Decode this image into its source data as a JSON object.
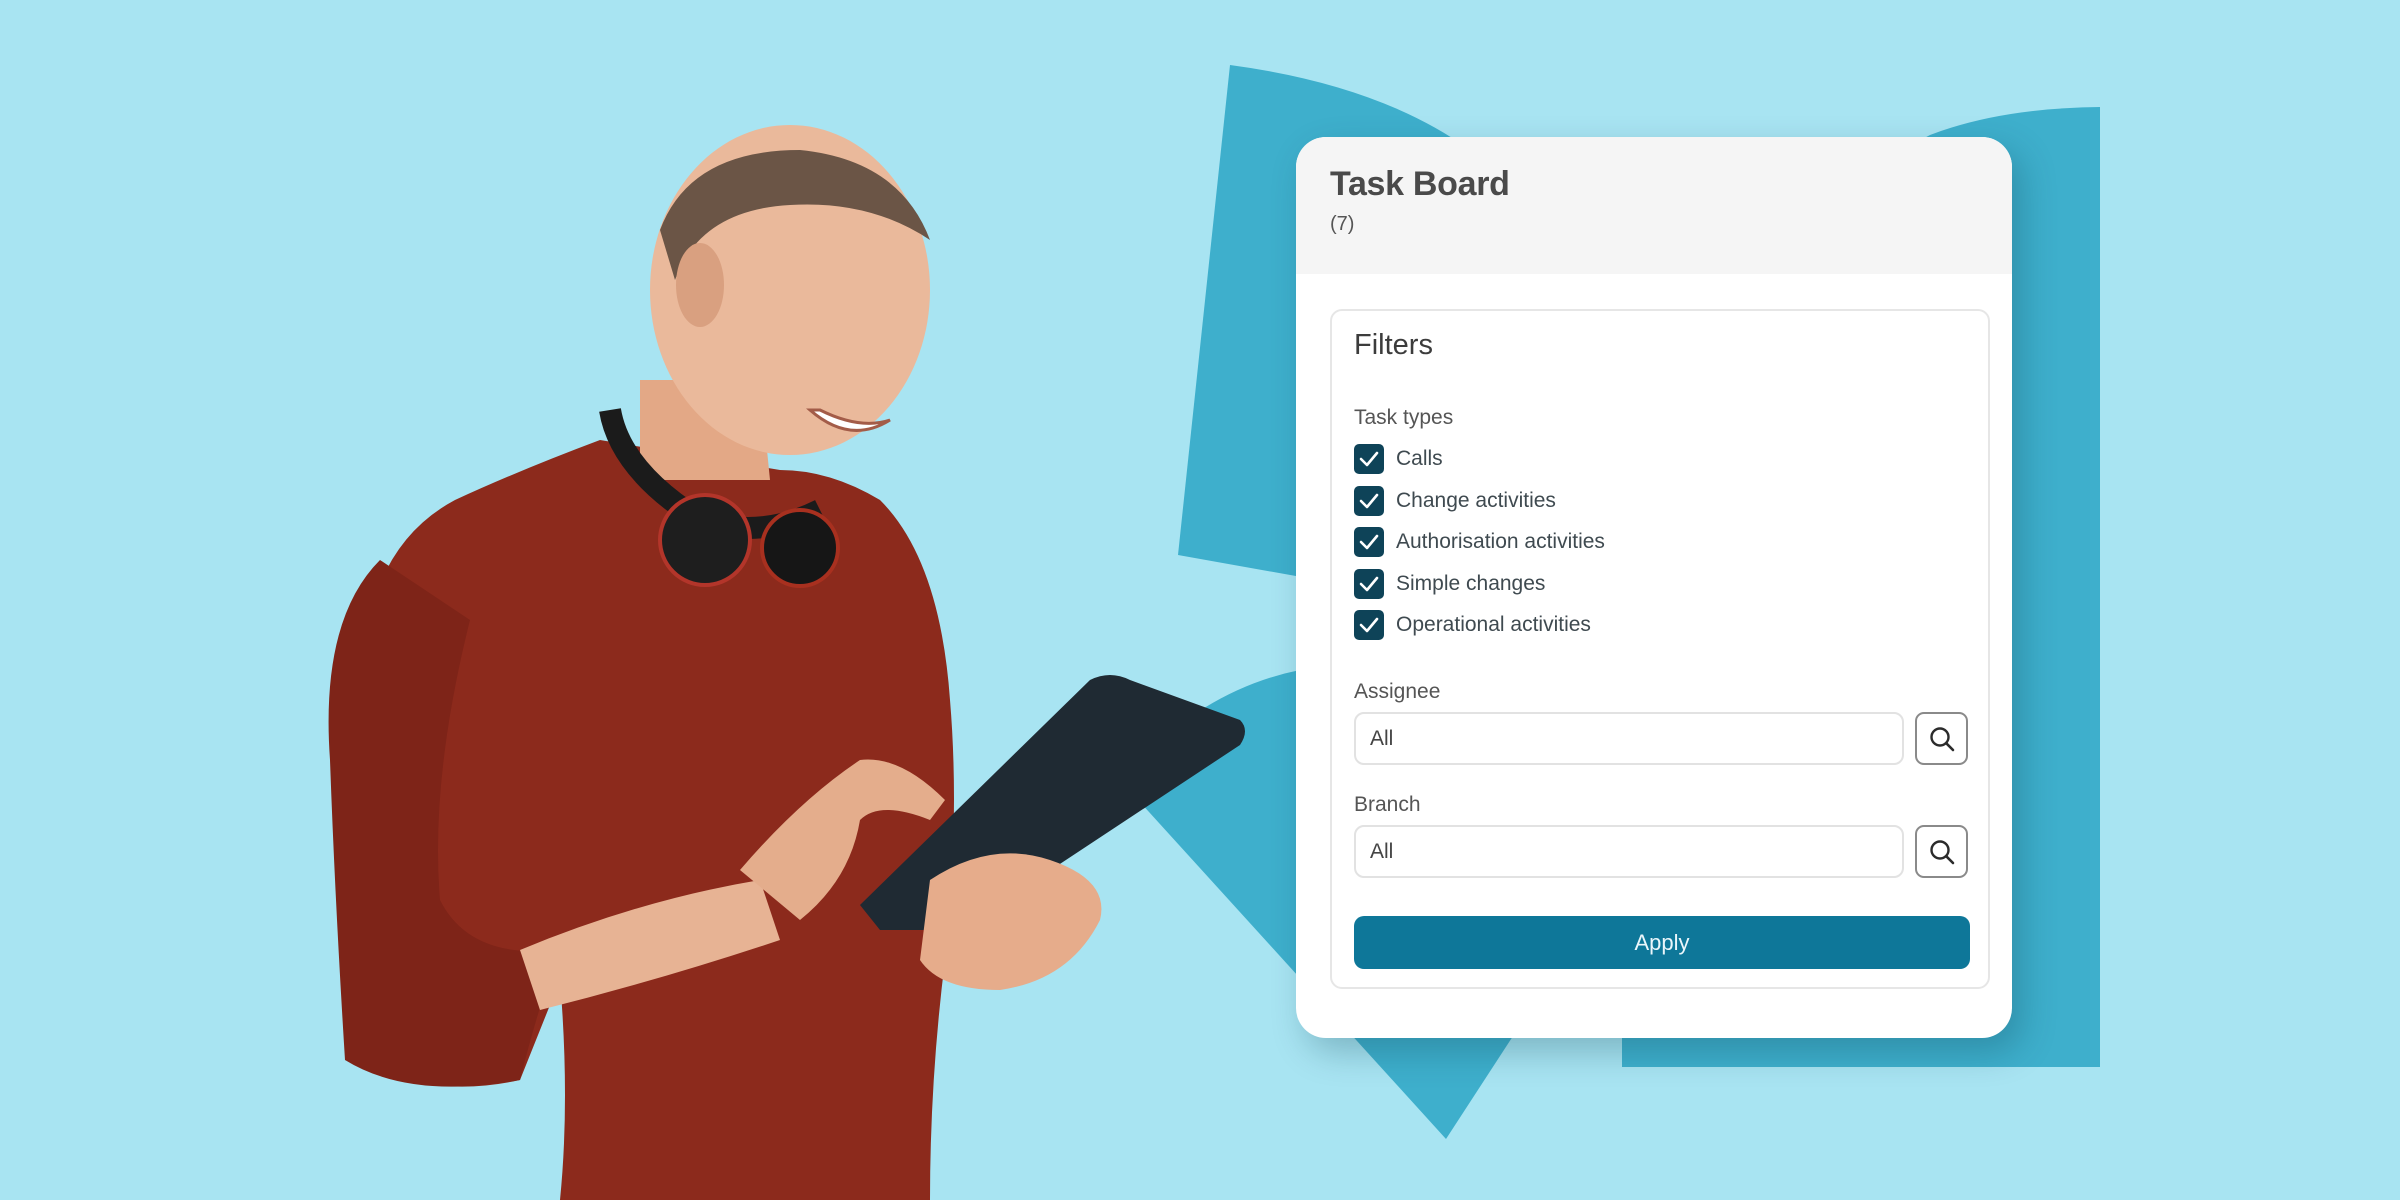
{
  "colors": {
    "background": "#a8e4f2",
    "shape": "#3eafcc",
    "accent": "#0e7799",
    "checkbox": "#0e4358",
    "sweater": "#8c2a1c",
    "skin": "#e7b394",
    "tablet": "#1f2a33"
  },
  "photo": {
    "description": "Smiling man in red knit sweater with headphones around neck using a tablet"
  },
  "card": {
    "title": "Task Board",
    "count": "(7)"
  },
  "filters": {
    "title": "Filters",
    "task_types": {
      "label": "Task types",
      "items": [
        {
          "label": "Calls",
          "checked": true
        },
        {
          "label": "Change activities",
          "checked": true
        },
        {
          "label": "Authorisation activities",
          "checked": true
        },
        {
          "label": "Simple changes",
          "checked": true
        },
        {
          "label": "Operational activities",
          "checked": true
        }
      ]
    },
    "assignee": {
      "label": "Assignee",
      "value": "All",
      "search_icon": "search-icon"
    },
    "branch": {
      "label": "Branch",
      "value": "All",
      "search_icon": "search-icon"
    },
    "apply_label": "Apply"
  }
}
